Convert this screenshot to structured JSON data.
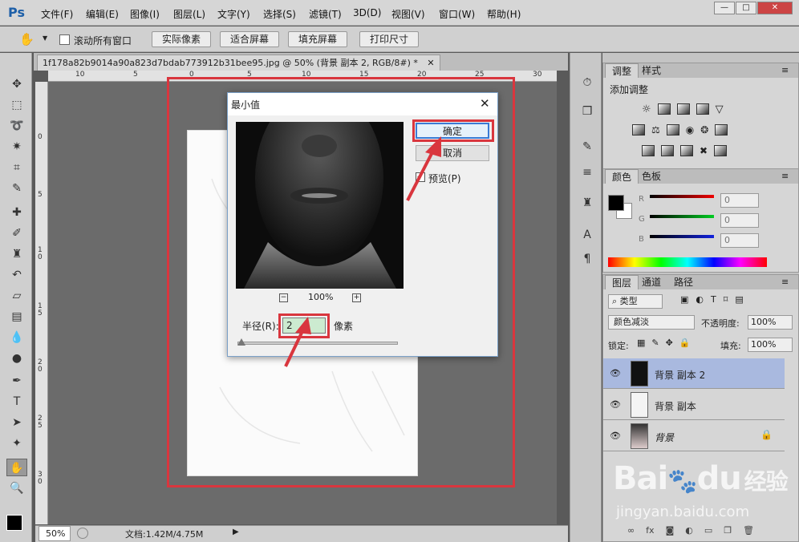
{
  "app": {
    "logo": "Ps"
  },
  "menu": [
    "文件(F)",
    "编辑(E)",
    "图像(I)",
    "图层(L)",
    "文字(Y)",
    "选择(S)",
    "滤镜(T)",
    "3D(D)",
    "视图(V)",
    "窗口(W)",
    "帮助(H)"
  ],
  "window_controls": {
    "minimize": "—",
    "restore": "□",
    "close": "✕"
  },
  "options": {
    "scroll_all_label": "滚动所有窗口",
    "buttons": [
      "实际像素",
      "适合屏幕",
      "填充屏幕",
      "打印尺寸"
    ]
  },
  "document": {
    "tab_title": "1f178a82b9014a90a823d7bdab773912b31bee95.jpg @ 50% (背景 副本 2, RGB/8#) *",
    "ruler_top": [
      "10",
      "5",
      "0",
      "5",
      "10",
      "15",
      "20",
      "25",
      "30"
    ],
    "ruler_left": [
      "0",
      "5",
      "1\n0",
      "1\n5",
      "2\n0",
      "2\n5",
      "3\n0"
    ]
  },
  "status": {
    "zoom": "50%",
    "doc_info": "文档:1.42M/4.75M"
  },
  "dialog": {
    "title": "最小值",
    "ok_label": "确定",
    "cancel_label": "取消",
    "preview_label": "预览(P)",
    "zoom_label": "100%",
    "radius_label": "半径(R):",
    "radius_value": "2",
    "unit_label": "像素"
  },
  "panels": {
    "adjust_tabs": [
      "调整",
      "样式"
    ],
    "add_adjust_label": "添加调整",
    "color_tabs": [
      "颜色",
      "色板"
    ],
    "channels": [
      {
        "label": "R",
        "value": "0",
        "color": "#cc1111"
      },
      {
        "label": "G",
        "value": "0",
        "color": "#11aa22"
      },
      {
        "label": "B",
        "value": "0",
        "color": "#1122cc"
      }
    ],
    "layer_tabs": [
      "图层",
      "通道",
      "路径"
    ],
    "kind_label": "类型",
    "blend_mode": "颜色减淡",
    "opacity_label": "不透明度:",
    "opacity_value": "100%",
    "lock_label": "锁定:",
    "fill_label": "填充:",
    "fill_value": "100%",
    "layers": [
      {
        "name": "背景 副本 2",
        "selected": true
      },
      {
        "name": "背景 副本",
        "selected": false
      },
      {
        "name": "背景",
        "selected": false
      }
    ]
  },
  "watermark": {
    "brand": "Bai",
    "brand2": "du",
    "suffix": "经验",
    "url": "jingyan.baidu.com"
  },
  "colors": {
    "highlight": "#d9363e",
    "selected_layer": "#a9b9df"
  }
}
